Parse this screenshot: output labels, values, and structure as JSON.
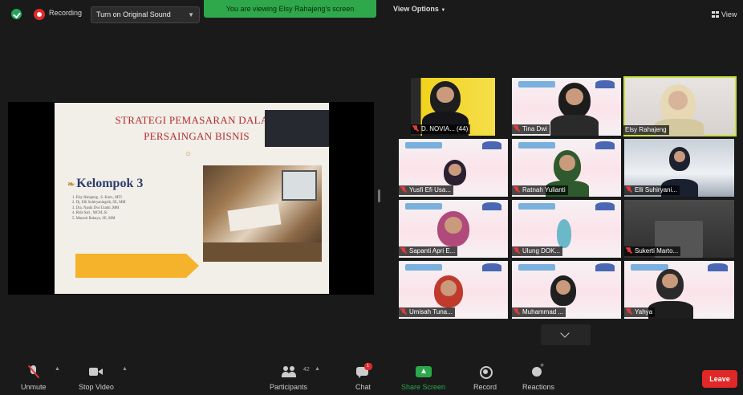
{
  "topbar": {
    "recording_label": "Recording",
    "original_sound_label": "Turn on Original Sound",
    "viewing_banner": "You are viewing Elsy Rahajeng's screen",
    "view_options_label": "View Options",
    "view_label": "View"
  },
  "slide": {
    "title_line1": "STRATEGI PEMASARAN DALAM",
    "title_line2": "PERSAINGAN BISNIS",
    "ornament": "☼",
    "group_ornament": "❧",
    "group_title": "Kelompok 3",
    "members": [
      "1. Elsy Rahajeng , S. Kom., MTI",
      "2. Dj. Elli Suhiryaningsih, SE, MM",
      "3. Dra. Nanik Dwi Utami ,MM",
      "4. Rida Sari , MCM.,Si",
      "5. Masroti Rohayu, SE, MM"
    ]
  },
  "gallery": [
    {
      "name": "D. NOVIA... (44)"
    },
    {
      "name": "Tina Dwi"
    },
    {
      "name": "Elsy Rahajeng"
    },
    {
      "name": "Yusfi Efi Usa..."
    },
    {
      "name": "Ratnah Yulianti"
    },
    {
      "name": "Elli Suhiryani..."
    },
    {
      "name": "Sapanti Apri E..."
    },
    {
      "name": "Ulung DOK..."
    },
    {
      "name": "Sukerti Marto..."
    },
    {
      "name": "Umisah Tuna..."
    },
    {
      "name": "Muhammad ..."
    },
    {
      "name": "Yahya"
    }
  ],
  "toolbar": {
    "unmute_label": "Unmute",
    "stop_video_label": "Stop Video",
    "participants_label": "Participants",
    "participants_count": "42",
    "chat_label": "Chat",
    "chat_badge": "1",
    "share_screen_label": "Share Screen",
    "record_label": "Record",
    "reactions_label": "Reactions",
    "leave_label": "Leave",
    "caret": "▲"
  },
  "colors": {
    "share_green": "#2aa84a",
    "leave_red": "#e02828",
    "active_speaker": "#c8e23a",
    "slide_title": "#b02e2e",
    "slide_group": "#2b3d6e",
    "slide_arrow": "#f4b32a"
  },
  "icons": [
    "security-shield-icon",
    "recording-icon",
    "grid-view-icon",
    "mic-muted-icon",
    "video-icon",
    "participants-icon",
    "chat-icon",
    "share-screen-icon",
    "record-icon",
    "reactions-icon",
    "chevron-down-icon"
  ]
}
